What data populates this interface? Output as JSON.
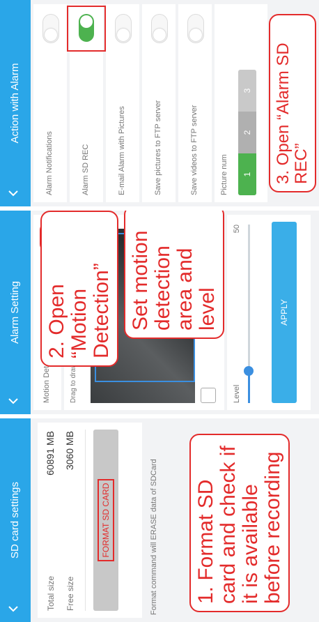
{
  "screen_sd": {
    "title": "SD card settings",
    "total_size_label": "Total size",
    "total_size_value": "60891 MB",
    "free_size_label": "Free size",
    "free_size_value": "3060 MB",
    "format_button_label": "FORMAT SD CARD",
    "format_note": "Format command will ERASE data of SDCard",
    "callout": "1. Format SD card and check if it is available before recording"
  },
  "screen_alarm": {
    "title": "Alarm Setting",
    "motion_detection_label": "Motion Detection",
    "motion_detection_on": true,
    "drag_hint": "Drag to draw a picture area that needs to monitor",
    "level_label": "Level",
    "level_value": 50,
    "level_max": 100,
    "level_fraction": 0.18,
    "apply_button_label": "APPLY",
    "callout_motion": "2. Open “Motion Detection”",
    "callout_area": "Set motion detection area and level"
  },
  "screen_action": {
    "title": "Action with Alarm",
    "items": [
      {
        "label": "Alarm Notifications",
        "on": false
      },
      {
        "label": "Alarm SD REC",
        "on": true
      },
      {
        "label": "E-mail Alarm with Pictures",
        "on": false
      },
      {
        "label": "Save pictures to FTP server",
        "on": false
      },
      {
        "label": "Save videos to FTP server",
        "on": false
      }
    ],
    "picture_num_label": "Picture num",
    "picture_num_options": [
      "1",
      "2",
      "3"
    ],
    "picture_num_selected": "1",
    "callout": "3. Open “Alarm SD REC”"
  },
  "colors": {
    "header": "#2aa6e8",
    "accent_green": "#4db24f",
    "callout_red": "#e32b2b",
    "apply_blue": "#3aaee8"
  }
}
